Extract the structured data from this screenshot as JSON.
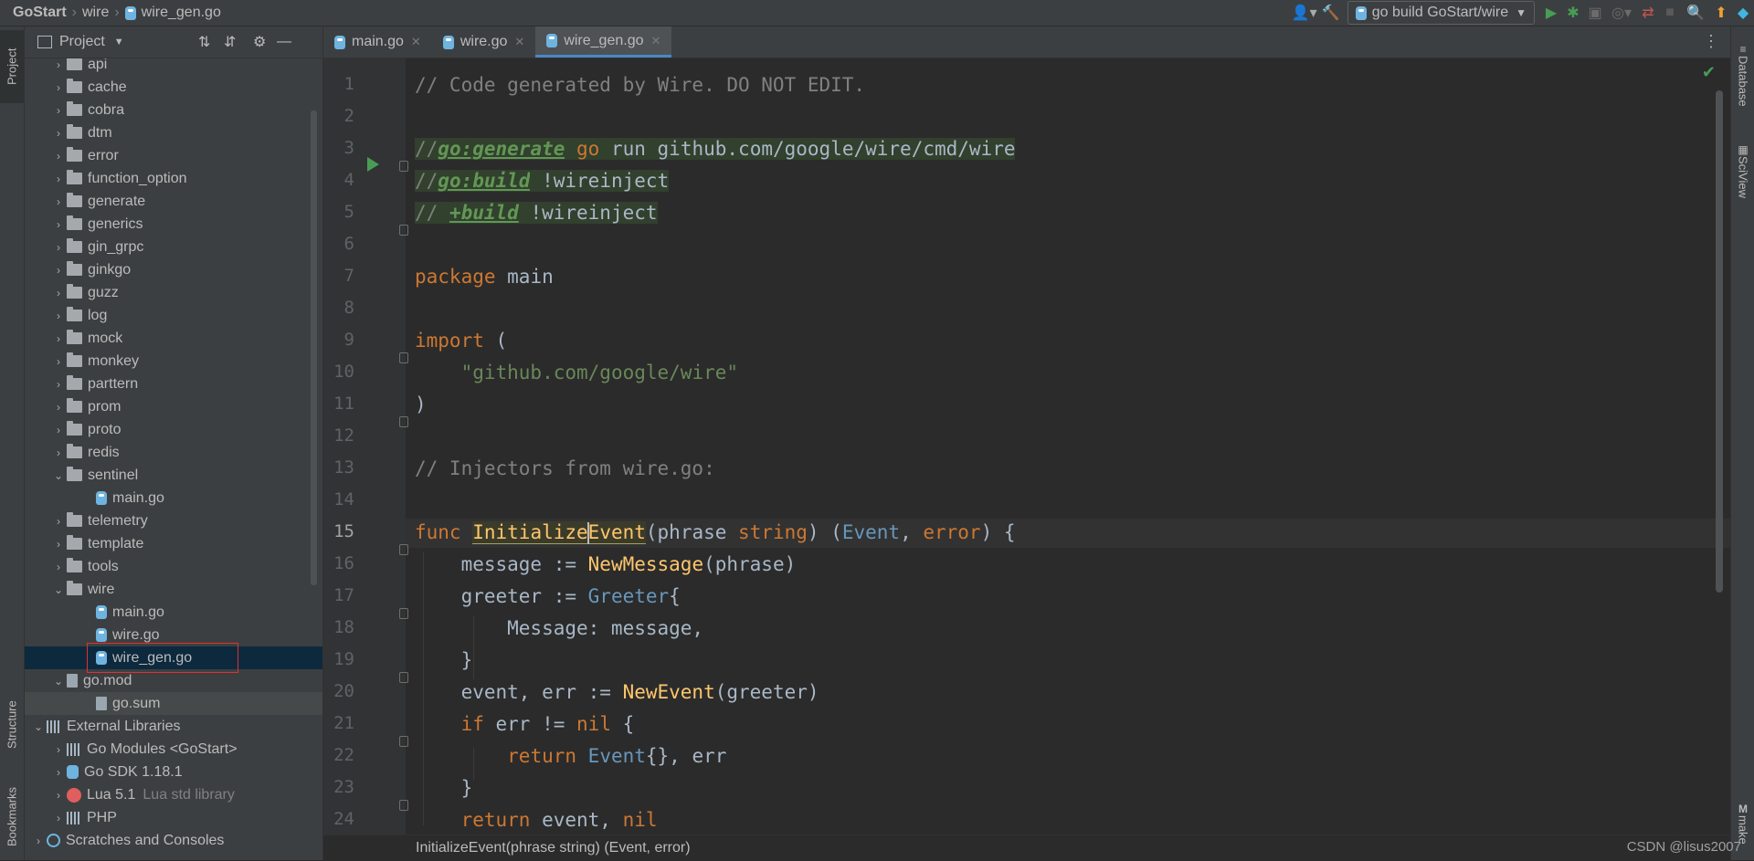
{
  "breadcrumb": {
    "project": "GoStart",
    "folder": "wire",
    "file": "wire_gen.go"
  },
  "toolbar": {
    "run_config": "go build GoStart/wire"
  },
  "left_stripe": {
    "project_tab": "Project",
    "structure_tab": "Structure",
    "bookmarks_tab": "Bookmarks"
  },
  "right_stripe": {
    "database_tab": "Database",
    "sciview_tab": "SciView",
    "make_tab": "make"
  },
  "project_panel": {
    "title": "Project",
    "items": [
      {
        "label": "api"
      },
      {
        "label": "cache"
      },
      {
        "label": "cobra"
      },
      {
        "label": "dtm"
      },
      {
        "label": "error"
      },
      {
        "label": "function_option"
      },
      {
        "label": "generate"
      },
      {
        "label": "generics"
      },
      {
        "label": "gin_grpc"
      },
      {
        "label": "ginkgo"
      },
      {
        "label": "guzz"
      },
      {
        "label": "log"
      },
      {
        "label": "mock"
      },
      {
        "label": "monkey"
      },
      {
        "label": "parttern"
      },
      {
        "label": "prom"
      },
      {
        "label": "proto"
      },
      {
        "label": "redis"
      },
      {
        "label": "sentinel"
      },
      {
        "label": "main.go"
      },
      {
        "label": "telemetry"
      },
      {
        "label": "template"
      },
      {
        "label": "tools"
      },
      {
        "label": "wire"
      },
      {
        "label": "main.go"
      },
      {
        "label": "wire.go"
      },
      {
        "label": "wire_gen.go"
      },
      {
        "label": "go.mod"
      },
      {
        "label": "go.sum"
      },
      {
        "label": "External Libraries"
      },
      {
        "label": "Go Modules <GoStart>"
      },
      {
        "label": "Go SDK 1.18.1"
      },
      {
        "label": "Lua 5.1",
        "hint": "Lua std library"
      },
      {
        "label": "PHP"
      },
      {
        "label": "Scratches and Consoles"
      }
    ]
  },
  "editor": {
    "tabs": [
      {
        "label": "main.go"
      },
      {
        "label": "wire.go"
      },
      {
        "label": "wire_gen.go"
      }
    ],
    "active_tab": "wire_gen.go",
    "line_numbers": [
      "1",
      "2",
      "3",
      "4",
      "5",
      "6",
      "7",
      "8",
      "9",
      "10",
      "11",
      "12",
      "13",
      "14",
      "15",
      "16",
      "17",
      "18",
      "19",
      "20",
      "21",
      "22",
      "23",
      "24"
    ],
    "current_line": "15",
    "code_lines": [
      "// Code generated by Wire. DO NOT EDIT.",
      "",
      "//go:generate go run github.com/google/wire/cmd/wire",
      "//go:build !wireinject",
      "// +build !wireinject",
      "",
      "package main",
      "",
      "import (",
      "    \"github.com/google/wire\"",
      ")",
      "",
      "// Injectors from wire.go:",
      "",
      "func InitializeEvent(phrase string) (Event, error) {",
      "    message := NewMessage(phrase)",
      "    greeter := Greeter{",
      "        Message: message,",
      "    }",
      "    event, err := NewEvent(greeter)",
      "    if err != nil {",
      "        return Event{}, err",
      "    }",
      "    return event, nil"
    ],
    "status_breadcrumb": "InitializeEvent(phrase string) (Event, error)"
  },
  "watermark": "CSDN @lisus2007",
  "colors": {
    "background": "#2b2b2b",
    "panel": "#3c3f41",
    "selection": "#0d293e",
    "keyword": "#cc7832",
    "string": "#6a8759",
    "function": "#ffc66d",
    "comment": "#808080",
    "highlight_box": "#e0322f"
  }
}
